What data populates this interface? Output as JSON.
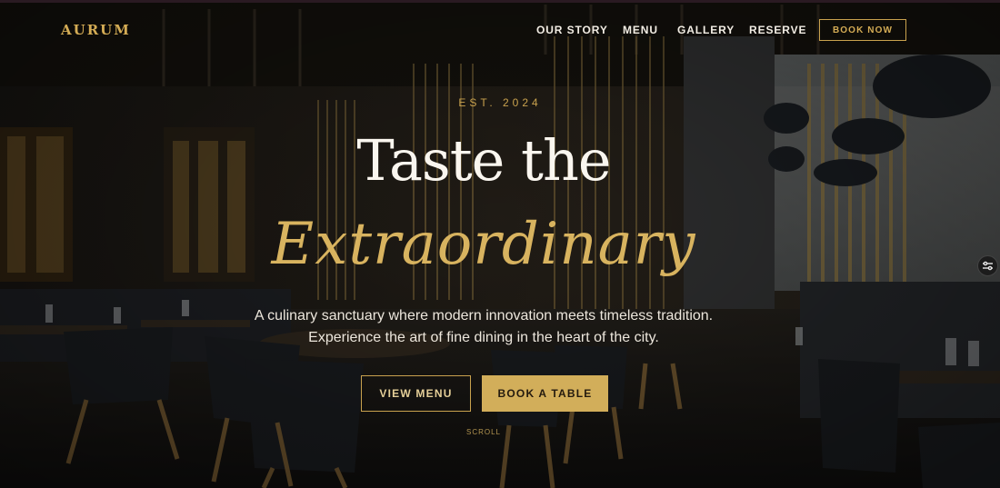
{
  "brand": {
    "logo_text": "AURUM"
  },
  "nav": {
    "items": [
      {
        "label": "OUR STORY"
      },
      {
        "label": "MENU"
      },
      {
        "label": "GALLERY"
      },
      {
        "label": "RESERVE"
      }
    ],
    "cta_label": "BOOK NOW"
  },
  "hero": {
    "eyebrow": "EST. 2024",
    "title_line1": "Taste the",
    "title_line2": "Extraordinary",
    "subtitle_line1": "A culinary sanctuary where modern innovation meets timeless tradition.",
    "subtitle_line2": "Experience the art of fine dining in the heart of the city.",
    "primary_button": "VIEW MENU",
    "secondary_button": "BOOK A TABLE",
    "scroll_label": "SCROLL"
  },
  "icons": {
    "side_widget": "sliders-icon"
  },
  "colors": {
    "accent_gold": "#d2ae5a",
    "text_light": "#f2ede4",
    "background_dark": "#16120e"
  }
}
